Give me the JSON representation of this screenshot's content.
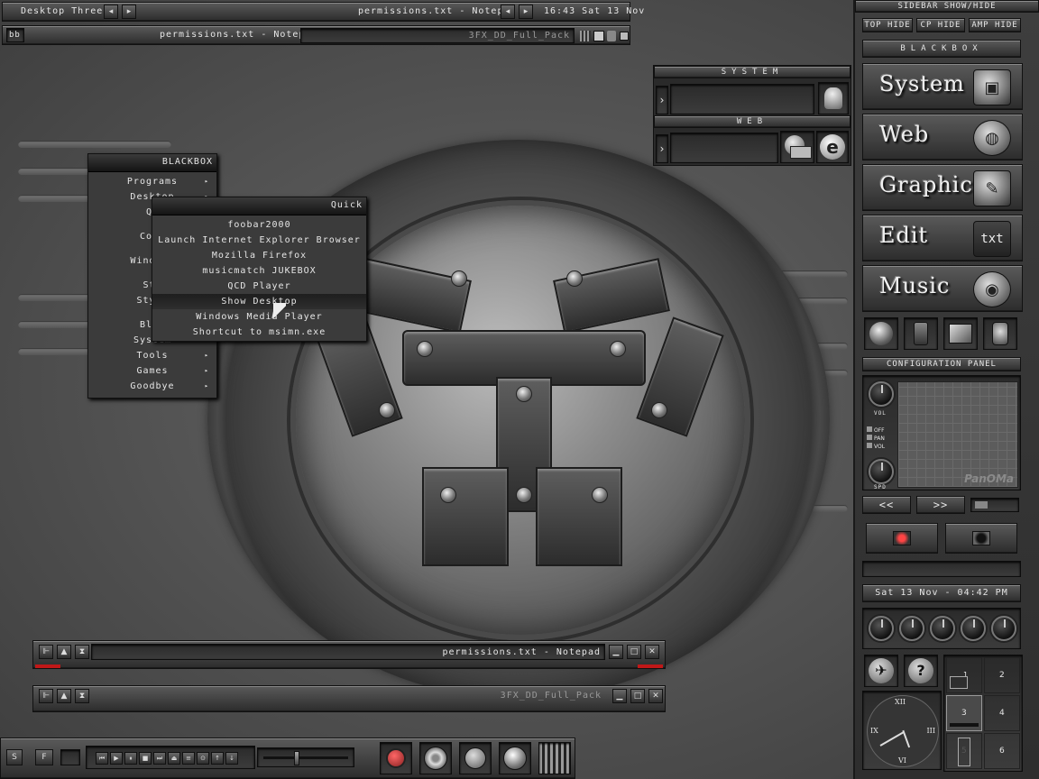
{
  "topbar": {
    "workspace": "Desktop Three",
    "window_title": "permissions.txt - Notepad",
    "clock": "16:43 Sat 13 Nov"
  },
  "topbar2": {
    "bb_label": "bb",
    "active_task": "permissions.txt - Notepad",
    "inactive_task": "3FX_DD_Full_Pack"
  },
  "blackbox_menu": {
    "title": "BLACKBOX",
    "items": [
      {
        "label": "Programs",
        "submenu": true
      },
      {
        "label": "Desktop",
        "submenu": true
      },
      {
        "label": "Qu",
        "submenu": false
      },
      {
        "label": "Comp",
        "submenu": false
      },
      {
        "label": "Windows",
        "submenu": false
      },
      {
        "label": "Sty",
        "submenu": false
      },
      {
        "label": "Style",
        "submenu": false
      },
      {
        "label": "Blac",
        "submenu": false
      },
      {
        "label": "System",
        "submenu": true
      },
      {
        "label": "Tools",
        "submenu": true
      },
      {
        "label": "Games",
        "submenu": true
      },
      {
        "label": "Goodbye",
        "submenu": true
      }
    ]
  },
  "quick_menu": {
    "title": "Quick",
    "items": [
      "foobar2000",
      "Launch Internet Explorer Browser",
      "Mozilla Firefox",
      "musicmatch JUKEBOX",
      "QCD Player",
      "Show Desktop",
      "Windows Media Player",
      "Shortcut to msimn.exe"
    ],
    "active_index": 5
  },
  "system_panel": {
    "system_title": "SYSTEM",
    "web_title": "WEB"
  },
  "sidebar": {
    "header": "SIDEBAR SHOW/HIDE",
    "hide_buttons": [
      "TOP HIDE",
      "CP HIDE",
      "AMP HIDE"
    ],
    "blackbox_label": "BLACKBOX",
    "big_buttons": [
      {
        "label": "System",
        "icon": "monitor-icon"
      },
      {
        "label": "Web",
        "icon": "globe-icon"
      },
      {
        "label": "Graphics",
        "icon": "pen-icon"
      },
      {
        "label": "Edit",
        "icon": "txt-icon",
        "icon_text": "txt"
      },
      {
        "label": "Music",
        "icon": "disc-icon"
      }
    ],
    "config_title": "CONFIGURATION PANEL",
    "vol_label": "VOL",
    "spd_label": "SPD",
    "toggles": [
      "OFF",
      "PAN",
      "VOL"
    ],
    "panoma_label": "PanOMa",
    "rewind": "<<",
    "forward": ">>",
    "date_display": "Sat 13 Nov - 04:42 PM",
    "workspaces": [
      "1",
      "2",
      "3",
      "4",
      "5",
      "6"
    ],
    "active_workspace": 3,
    "clock_numerals": {
      "top": "XII",
      "right": "III",
      "left": "IX",
      "bottom": "VI"
    }
  },
  "taskwindows": [
    {
      "title": "permissions.txt - Notepad"
    },
    {
      "title": "3FX_DD_Full_Pack"
    }
  ],
  "bottom_bar": {
    "btn_s": "S",
    "btn_f": "F",
    "media_controls": [
      "⏮",
      "▶",
      "⏸",
      "■",
      "⏭",
      "⏏",
      "≡",
      "⊙",
      "↑",
      "↓"
    ]
  }
}
